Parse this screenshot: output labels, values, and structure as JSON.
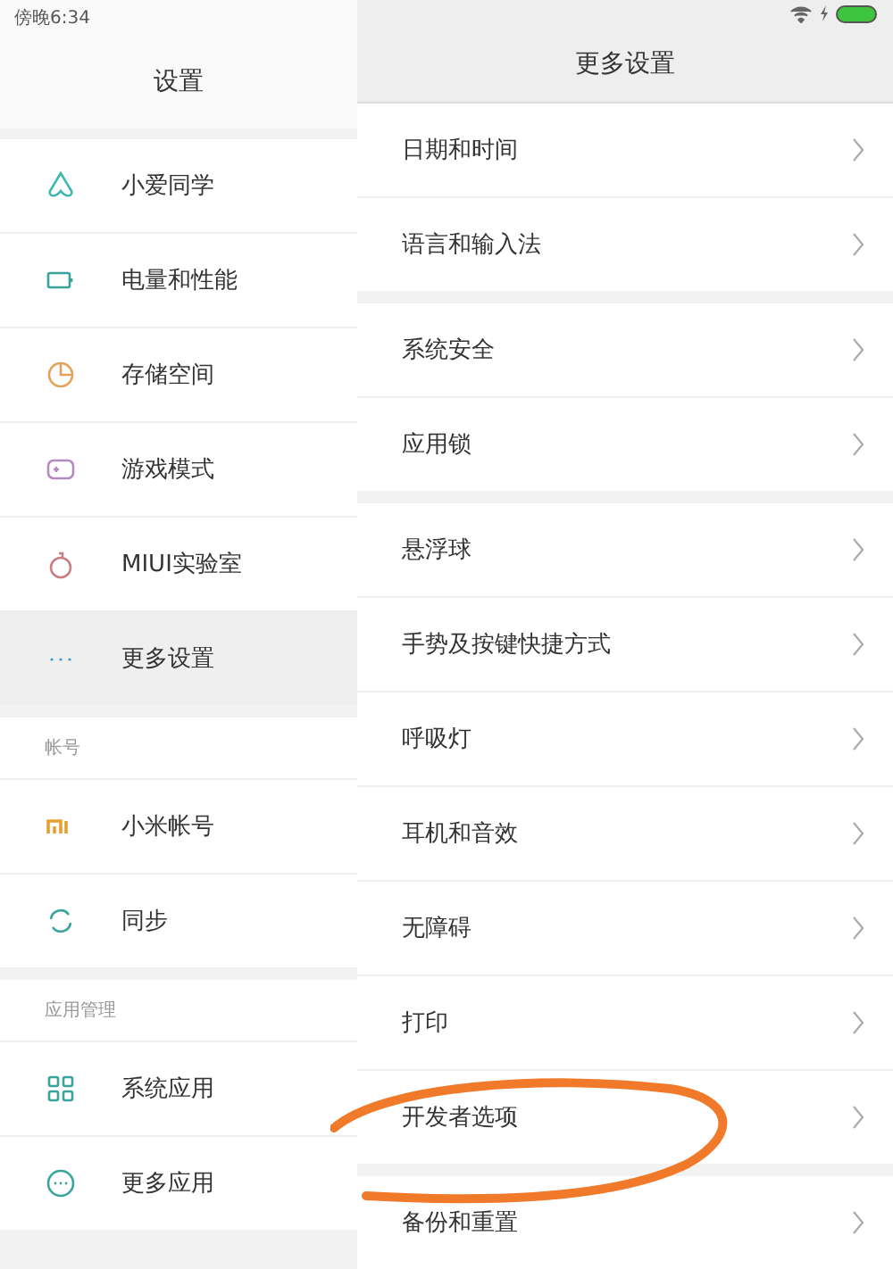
{
  "status_bar": {
    "time": "傍晚6:34"
  },
  "sidebar": {
    "title": "设置",
    "groups": [
      {
        "items": [
          {
            "label": "小爱同学",
            "kind": "assistant",
            "selected": false
          },
          {
            "label": "电量和性能",
            "kind": "battery",
            "selected": false
          },
          {
            "label": "存储空间",
            "kind": "storage",
            "selected": false
          },
          {
            "label": "游戏模式",
            "kind": "game",
            "selected": false
          },
          {
            "label": "MIUI实验室",
            "kind": "lab",
            "selected": false
          },
          {
            "label": "更多设置",
            "kind": "dots",
            "selected": true
          }
        ]
      },
      {
        "header": "帐号",
        "items": [
          {
            "label": "小米帐号",
            "kind": "mi",
            "selected": false
          },
          {
            "label": "同步",
            "kind": "sync",
            "selected": false
          }
        ]
      },
      {
        "header": "应用管理",
        "items": [
          {
            "label": "系统应用",
            "kind": "grid",
            "selected": false
          },
          {
            "label": "更多应用",
            "kind": "circle-dots",
            "selected": false
          }
        ]
      }
    ]
  },
  "detail": {
    "title": "更多设置",
    "groups": [
      {
        "items": [
          {
            "label": "日期和时间"
          },
          {
            "label": "语言和输入法"
          }
        ]
      },
      {
        "items": [
          {
            "label": "系统安全"
          },
          {
            "label": "应用锁"
          }
        ]
      },
      {
        "items": [
          {
            "label": "悬浮球"
          },
          {
            "label": "手势及按键快捷方式"
          },
          {
            "label": "呼吸灯"
          },
          {
            "label": "耳机和音效"
          },
          {
            "label": "无障碍"
          },
          {
            "label": "打印"
          },
          {
            "label": "开发者选项"
          }
        ]
      },
      {
        "items": [
          {
            "label": "备份和重置"
          }
        ]
      }
    ]
  }
}
